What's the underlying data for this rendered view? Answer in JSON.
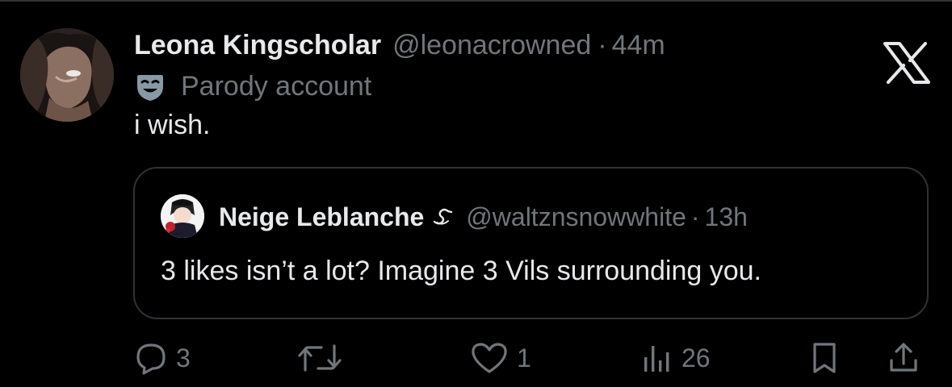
{
  "post": {
    "author_name": "Leona Kingscholar",
    "handle": "@leonacrowned",
    "separator": "·",
    "time": "44m",
    "label_text": "Parody account",
    "label_icon": "theater-mask-icon",
    "text": "i wish."
  },
  "quoted_post": {
    "author_name": "Neige Leblanche",
    "name_icon": "swan-icon",
    "handle": "@waltznsnowwhite",
    "separator": "·",
    "time": "13h",
    "text": "3 likes isn’t a lot? Imagine 3 Vils surrounding you."
  },
  "actions": {
    "replies": "3",
    "likes": "1",
    "views": "26"
  },
  "icons": {
    "brand": "x-logo-icon",
    "reply": "comment-bubble-icon",
    "retweet": "retweet-icon",
    "like": "heart-icon",
    "views": "bar-chart-icon",
    "bookmark": "bookmark-icon",
    "share": "share-upload-icon"
  },
  "colors": {
    "background": "#000000",
    "primary_text": "#e7e9ea",
    "secondary_text": "#71767b",
    "border": "#2f3336"
  }
}
